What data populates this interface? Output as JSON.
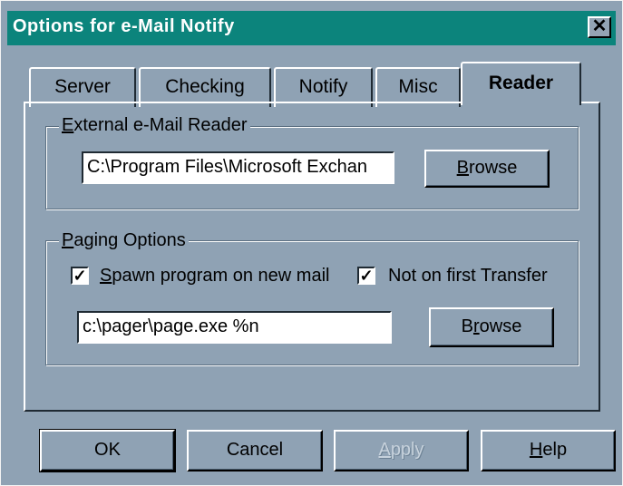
{
  "window": {
    "title": "Options for e-Mail Notify",
    "close_glyph": "✕"
  },
  "tabs": [
    {
      "label": "Server",
      "active": false
    },
    {
      "label": "Checking",
      "active": false
    },
    {
      "label": "Notify",
      "active": false
    },
    {
      "label": "Misc",
      "active": false
    },
    {
      "label": "Reader",
      "active": true
    }
  ],
  "external_reader": {
    "group_label_hotkey": "E",
    "group_label_rest": "xternal e-Mail Reader",
    "path_value": "C:\\Program Files\\Microsoft Exchan",
    "browse_hotkey": "B",
    "browse_rest": "rowse"
  },
  "paging": {
    "group_label_hotkey": "P",
    "group_label_rest": "aging Options",
    "spawn_hotkey": "S",
    "spawn_rest": "pawn program on new mail",
    "spawn_checked": true,
    "first_transfer_label": "Not on first Transfer",
    "first_transfer_checked": true,
    "check_glyph": "✓",
    "pager_value": "c:\\pager\\page.exe %n",
    "browse_pre": "B",
    "browse_hotkey": "r",
    "browse_rest": "owse"
  },
  "buttons": {
    "ok": "OK",
    "cancel": "Cancel",
    "apply_hotkey": "A",
    "apply_rest": "pply",
    "help_hotkey": "H",
    "help_rest": "elp"
  }
}
